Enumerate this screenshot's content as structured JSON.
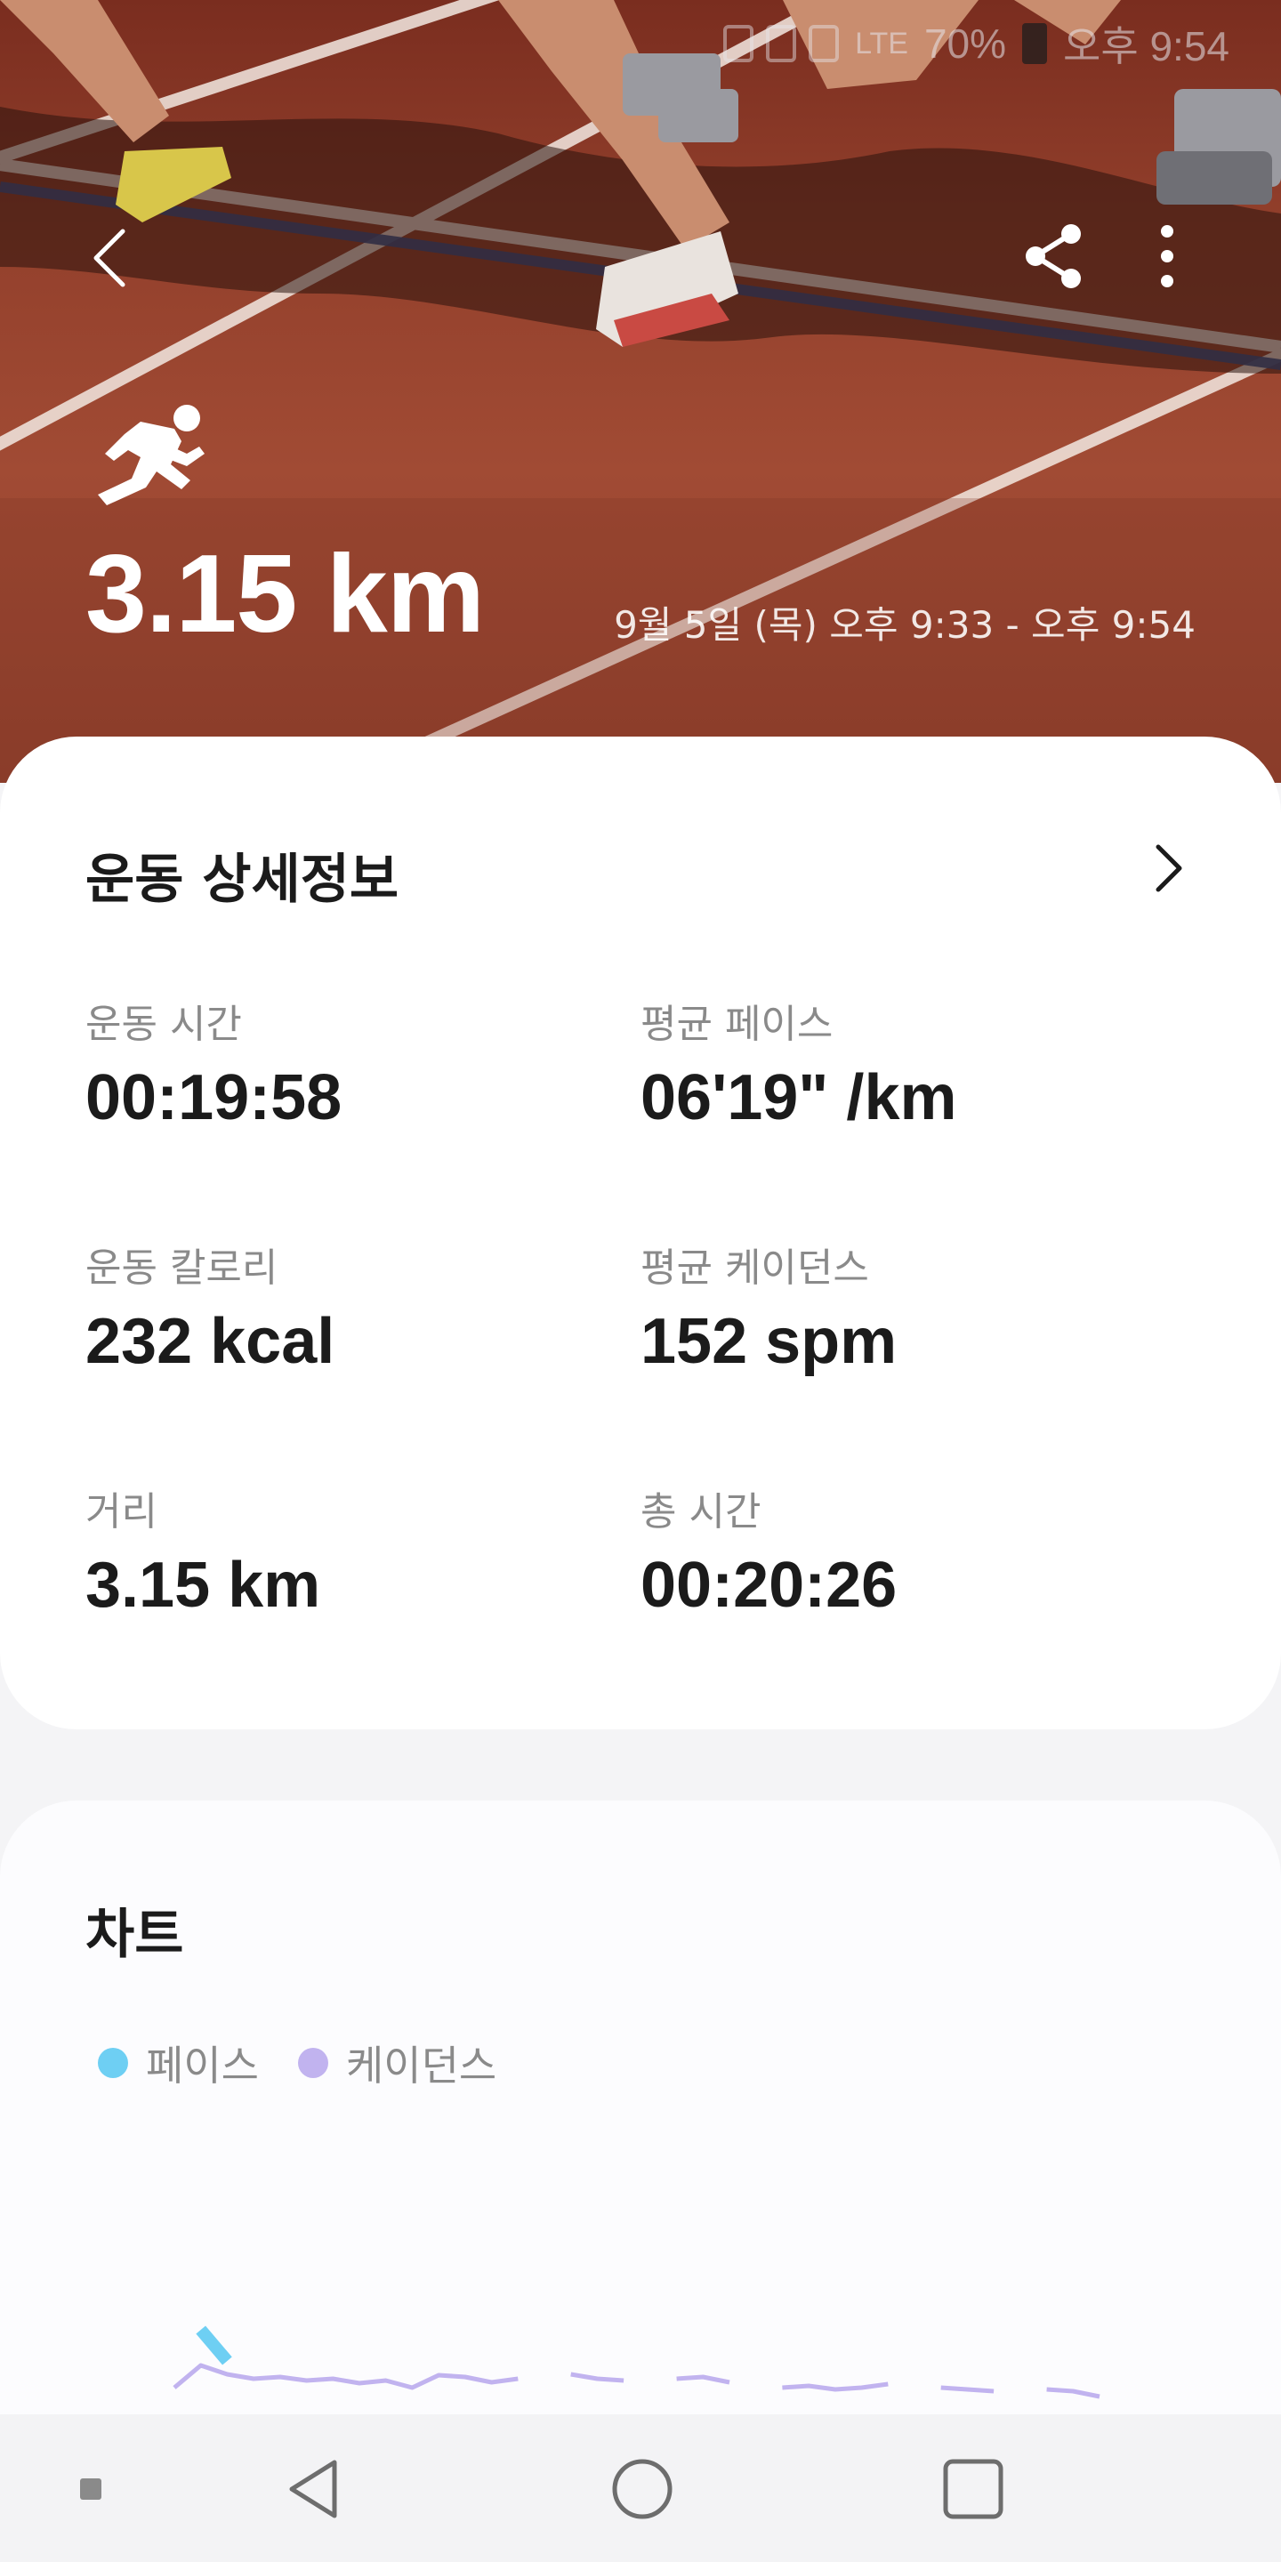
{
  "status_bar": {
    "battery": "70%",
    "time": "오후 9:54",
    "network": "LTE"
  },
  "header": {
    "activity_icon": "running-icon",
    "distance": "3.15 km",
    "date_range": "9월 5일 (목) 오후 9:33 - 오후 9:54"
  },
  "detail": {
    "title": "운동 상세정보",
    "stats": [
      {
        "label": "운동 시간",
        "value": "00:19:58"
      },
      {
        "label": "평균 페이스",
        "value": "06'19\" /km"
      },
      {
        "label": "운동 칼로리",
        "value": "232 kcal"
      },
      {
        "label": "평균 케이던스",
        "value": "152 spm"
      },
      {
        "label": "거리",
        "value": "3.15 km"
      },
      {
        "label": "총 시간",
        "value": "00:20:26"
      }
    ]
  },
  "chart_section": {
    "title": "차트",
    "legend": [
      {
        "name": "페이스",
        "color": "#6ecff3"
      },
      {
        "name": "케이던스",
        "color": "#c1b3ef"
      }
    ]
  },
  "chart_data": {
    "type": "area",
    "series": [
      {
        "name": "페이스",
        "color": "#6ecff3",
        "values": [
          0,
          95,
          60,
          0,
          0,
          0,
          0,
          0,
          0,
          0,
          0,
          0,
          0,
          0,
          0,
          0,
          0,
          0,
          0,
          0,
          40,
          0,
          0,
          0,
          0,
          0,
          0,
          0,
          0,
          0,
          0,
          0,
          0,
          0,
          0,
          0
        ]
      },
      {
        "name": "케이던스",
        "color": "#c1b3ef",
        "values": [
          30,
          55,
          45,
          40,
          42,
          38,
          40,
          35,
          38,
          30,
          44,
          42,
          36,
          40,
          0,
          45,
          40,
          38,
          0,
          40,
          42,
          36,
          0,
          30,
          32,
          28,
          30,
          34,
          0,
          30,
          28,
          26,
          0,
          28,
          26,
          20
        ]
      }
    ]
  },
  "colors": {
    "accent_pace": "#6ecff3",
    "accent_cadence": "#c1b3ef",
    "card_bg": "#ffffff",
    "label_gray": "#8a8a8a"
  },
  "icons": {
    "back": "back-arrow-icon",
    "share": "share-icon",
    "more": "more-vertical-icon",
    "detail_chevron": "chevron-right-icon"
  },
  "navbar": {
    "items": [
      "nav-indicator-icon",
      "nav-back-icon",
      "nav-home-icon",
      "nav-recents-icon"
    ]
  }
}
